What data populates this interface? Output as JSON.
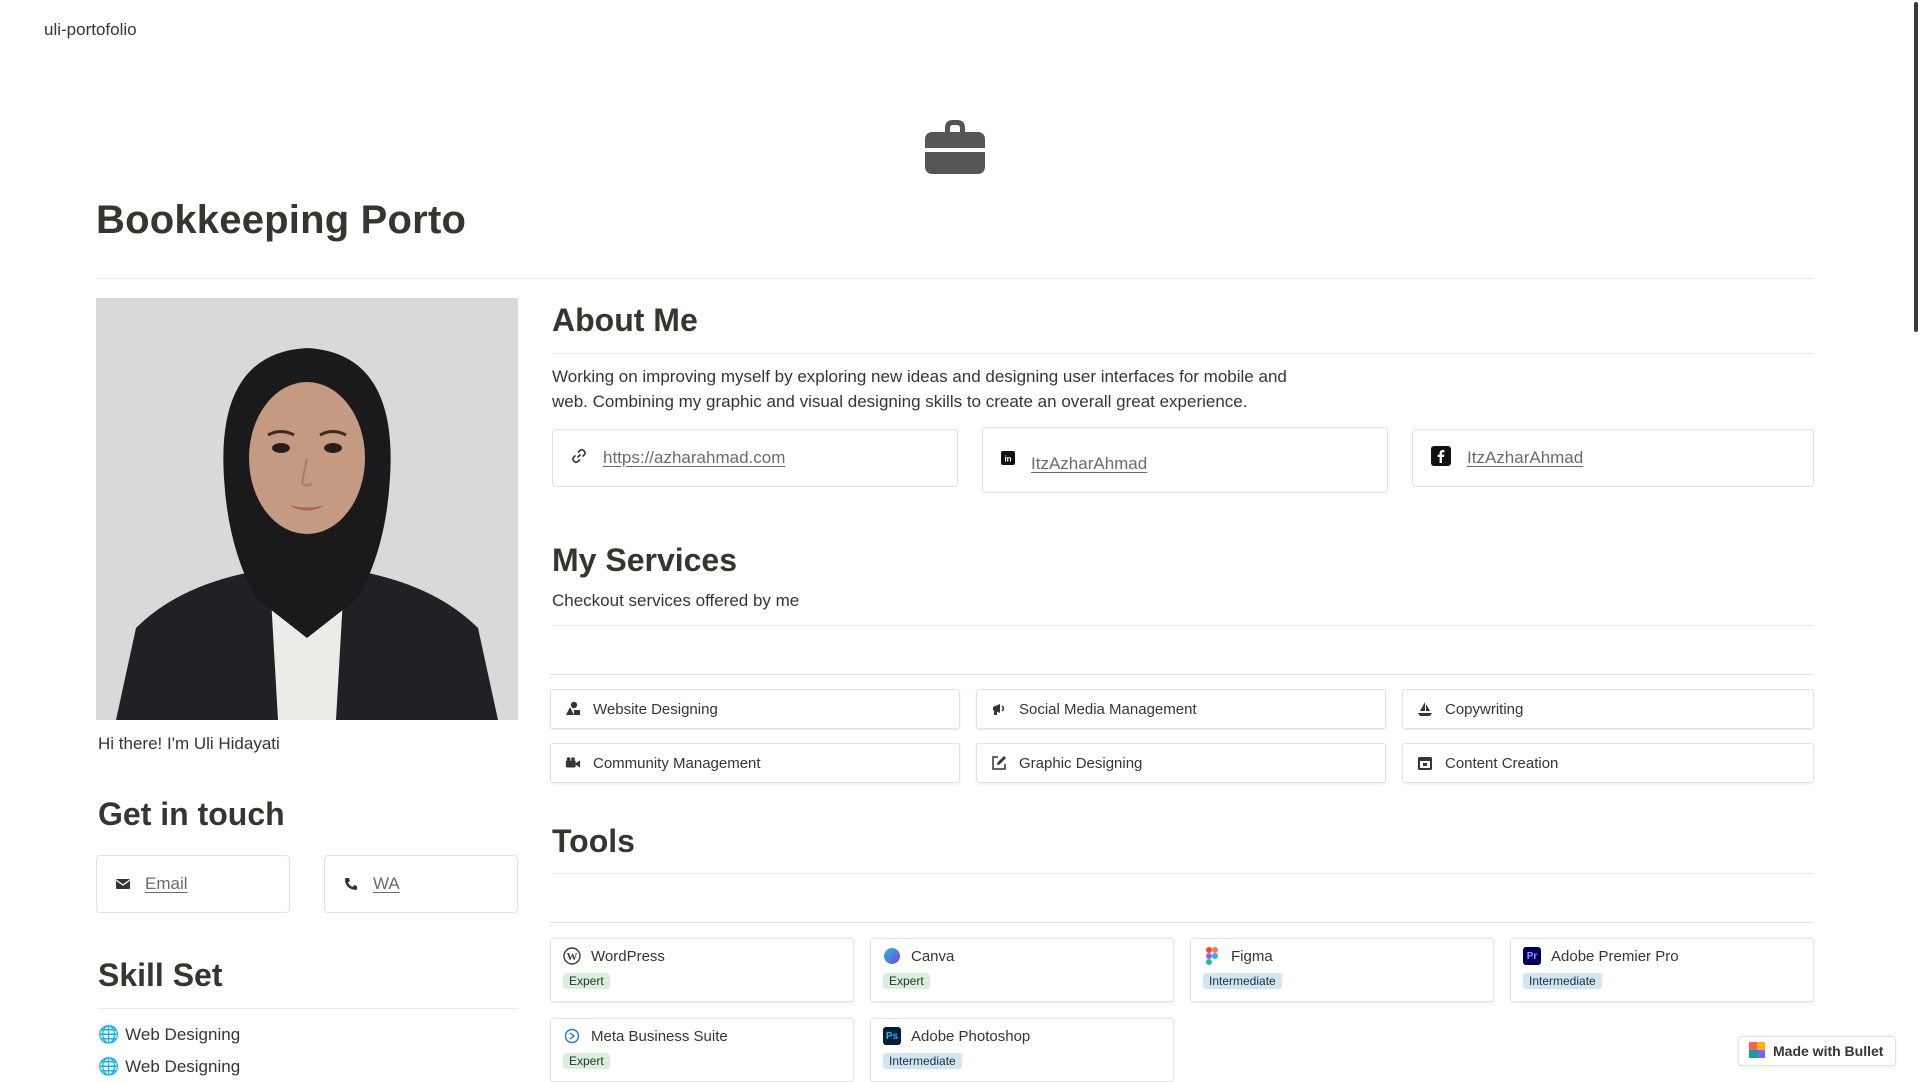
{
  "topbar": {
    "title": "uli-portofolio"
  },
  "page": {
    "title": "Bookkeeping Porto",
    "icon": "briefcase-icon"
  },
  "profile": {
    "greeting": "Hi there! I'm Uli Hidayati"
  },
  "get_in_touch": {
    "heading": "Get in touch",
    "email_label": "Email",
    "wa_label": "WA"
  },
  "skill_set": {
    "heading": "Skill Set",
    "items": [
      {
        "emoji": "🌐",
        "label": "Web Designing"
      },
      {
        "emoji": "🌐",
        "label": "Web Designing"
      }
    ]
  },
  "about": {
    "heading": "About Me",
    "text": "Working on improving myself by exploring new ideas and designing user interfaces for mobile and web. Combining my graphic and visual designing skills to create an overall great experience.",
    "links": [
      {
        "icon": "link-icon",
        "label": "https://azharahmad.com"
      },
      {
        "icon": "linkedin-icon",
        "label": "ItzAzharAhmad"
      },
      {
        "icon": "facebook-icon",
        "label": "ItzAzharAhmad"
      }
    ]
  },
  "services": {
    "heading": "My Services",
    "subtitle": "Checkout services offered by me",
    "items": [
      {
        "icon": "shapes-icon",
        "label": "Website Designing"
      },
      {
        "icon": "megaphone-icon",
        "label": "Social Media Management"
      },
      {
        "icon": "boat-icon",
        "label": "Copywriting"
      },
      {
        "icon": "camera-icon",
        "label": "Community Management"
      },
      {
        "icon": "edit-icon",
        "label": "Graphic Designing"
      },
      {
        "icon": "calendar-icon",
        "label": "Content Creation"
      }
    ]
  },
  "tools": {
    "heading": "Tools",
    "items": [
      {
        "icon": "wordpress-icon",
        "name": "WordPress",
        "level": "Expert"
      },
      {
        "icon": "canva-icon",
        "name": "Canva",
        "level": "Expert"
      },
      {
        "icon": "figma-icon",
        "name": "Figma",
        "level": "Intermediate"
      },
      {
        "icon": "premiere-icon",
        "name": "Adobe Premier Pro",
        "level": "Intermediate"
      },
      {
        "icon": "meta-icon",
        "name": "Meta Business Suite",
        "level": "Expert"
      },
      {
        "icon": "photoshop-icon",
        "name": "Adobe Photoshop",
        "level": "Intermediate"
      }
    ]
  },
  "footer_badge": {
    "label": "Made with Bullet"
  },
  "colors": {
    "text": "#37352f",
    "expert_badge": "#dbeddb",
    "intermediate_badge": "#d3e5ef",
    "photo_bg": "#d9d9d9"
  }
}
